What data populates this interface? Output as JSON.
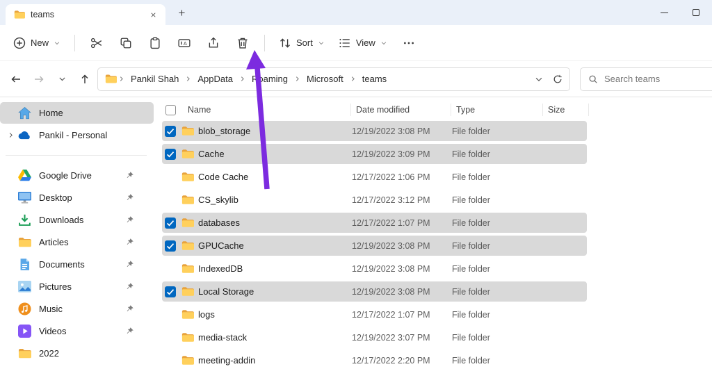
{
  "window": {
    "tab": {
      "title": "teams"
    }
  },
  "toolbar": {
    "new_label": "New",
    "actions": [
      "cut",
      "copy",
      "paste",
      "rename",
      "share",
      "delete"
    ],
    "sort_label": "Sort",
    "view_label": "View"
  },
  "nav": {
    "breadcrumbs": [
      "Pankil Shah",
      "AppData",
      "Roaming",
      "Microsoft",
      "teams"
    ],
    "search_placeholder": "Search teams"
  },
  "sidebar": {
    "items": [
      {
        "label": "Home",
        "icon": "home-icon",
        "selected": true,
        "expander": false,
        "pinned": false,
        "divider_after": false
      },
      {
        "label": "Pankil - Personal",
        "icon": "onedrive-icon",
        "selected": false,
        "expander": true,
        "pinned": false,
        "divider_after": true
      },
      {
        "label": "Google Drive",
        "icon": "gdrive-icon",
        "selected": false,
        "expander": false,
        "pinned": true,
        "divider_after": false
      },
      {
        "label": "Desktop",
        "icon": "desktop-icon",
        "selected": false,
        "expander": false,
        "pinned": true,
        "divider_after": false
      },
      {
        "label": "Downloads",
        "icon": "downloads-icon",
        "selected": false,
        "expander": false,
        "pinned": true,
        "divider_after": false
      },
      {
        "label": "Articles",
        "icon": "folder-icon",
        "selected": false,
        "expander": false,
        "pinned": true,
        "divider_after": false
      },
      {
        "label": "Documents",
        "icon": "documents-icon",
        "selected": false,
        "expander": false,
        "pinned": true,
        "divider_after": false
      },
      {
        "label": "Pictures",
        "icon": "pictures-icon",
        "selected": false,
        "expander": false,
        "pinned": true,
        "divider_after": false
      },
      {
        "label": "Music",
        "icon": "music-icon",
        "selected": false,
        "expander": false,
        "pinned": true,
        "divider_after": false
      },
      {
        "label": "Videos",
        "icon": "videos-icon",
        "selected": false,
        "expander": false,
        "pinned": true,
        "divider_after": false
      },
      {
        "label": "2022",
        "icon": "folder-icon",
        "selected": false,
        "expander": false,
        "pinned": false,
        "divider_after": false
      }
    ]
  },
  "file_list": {
    "columns": [
      "Name",
      "Date modified",
      "Type",
      "Size"
    ],
    "rows": [
      {
        "name": "blob_storage",
        "date_modified": "12/19/2022 3:08 PM",
        "type": "File folder",
        "size": "",
        "selected": true
      },
      {
        "name": "Cache",
        "date_modified": "12/19/2022 3:09 PM",
        "type": "File folder",
        "size": "",
        "selected": true
      },
      {
        "name": "Code Cache",
        "date_modified": "12/17/2022 1:06 PM",
        "type": "File folder",
        "size": "",
        "selected": false
      },
      {
        "name": "CS_skylib",
        "date_modified": "12/17/2022 3:12 PM",
        "type": "File folder",
        "size": "",
        "selected": false
      },
      {
        "name": "databases",
        "date_modified": "12/17/2022 1:07 PM",
        "type": "File folder",
        "size": "",
        "selected": true
      },
      {
        "name": "GPUCache",
        "date_modified": "12/19/2022 3:08 PM",
        "type": "File folder",
        "size": "",
        "selected": true
      },
      {
        "name": "IndexedDB",
        "date_modified": "12/19/2022 3:08 PM",
        "type": "File folder",
        "size": "",
        "selected": false
      },
      {
        "name": "Local Storage",
        "date_modified": "12/19/2022 3:08 PM",
        "type": "File folder",
        "size": "",
        "selected": true
      },
      {
        "name": "logs",
        "date_modified": "12/17/2022 1:07 PM",
        "type": "File folder",
        "size": "",
        "selected": false
      },
      {
        "name": "media-stack",
        "date_modified": "12/19/2022 3:07 PM",
        "type": "File folder",
        "size": "",
        "selected": false
      },
      {
        "name": "meeting-addin",
        "date_modified": "12/17/2022 2:20 PM",
        "type": "File folder",
        "size": "",
        "selected": false
      }
    ]
  },
  "annotation": {
    "arrow_color": "#7c2bdf",
    "points_at": "delete-button"
  }
}
